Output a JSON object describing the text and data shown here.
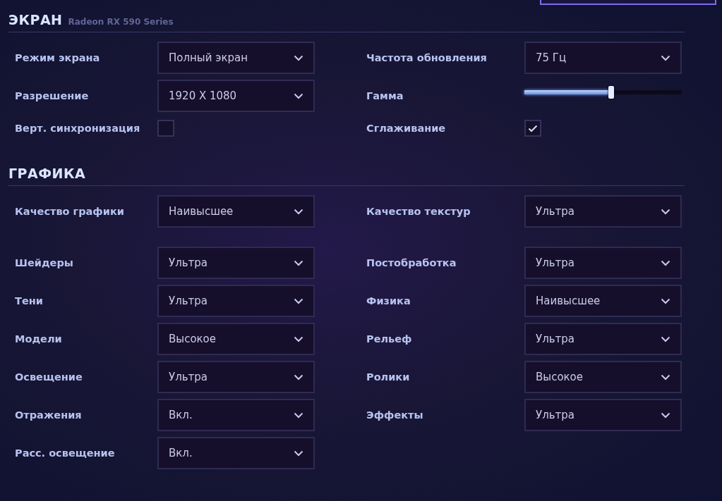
{
  "screen": {
    "title": "ЭКРАН",
    "subtitle": "Radeon RX 590 Series",
    "rows": [
      [
        {
          "kind": "dropdown",
          "label": "Режим экрана",
          "value": "Полный экран"
        },
        {
          "kind": "dropdown",
          "label": "Частота обновления",
          "value": "75 Гц"
        }
      ],
      [
        {
          "kind": "dropdown",
          "label": "Разрешение",
          "value": "1920 X 1080"
        },
        {
          "kind": "slider",
          "label": "Гамма",
          "level": 0.55
        }
      ],
      [
        {
          "kind": "checkbox",
          "label": "Верт. синхронизация",
          "checked": false
        },
        {
          "kind": "checkbox",
          "label": "Сглаживание",
          "checked": true
        }
      ]
    ]
  },
  "graphics": {
    "title": "ГРАФИКА",
    "rows": [
      [
        {
          "kind": "dropdown",
          "label": "Качество графики",
          "value": "Наивысшее"
        },
        {
          "kind": "dropdown",
          "label": "Качество текстур",
          "value": "Ультра"
        }
      ],
      [
        {
          "kind": "dropdown",
          "label": "Шейдеры",
          "value": "Ультра"
        },
        {
          "kind": "dropdown",
          "label": "Постобработка",
          "value": "Ультра"
        }
      ],
      [
        {
          "kind": "dropdown",
          "label": "Тени",
          "value": "Ультра"
        },
        {
          "kind": "dropdown",
          "label": "Физика",
          "value": "Наивысшее"
        }
      ],
      [
        {
          "kind": "dropdown",
          "label": "Модели",
          "value": "Высокое"
        },
        {
          "kind": "dropdown",
          "label": "Рельеф",
          "value": "Ультра"
        }
      ],
      [
        {
          "kind": "dropdown",
          "label": "Освещение",
          "value": "Ультра"
        },
        {
          "kind": "dropdown",
          "label": "Ролики",
          "value": "Высокое"
        }
      ],
      [
        {
          "kind": "dropdown",
          "label": "Отражения",
          "value": "Вкл."
        },
        {
          "kind": "dropdown",
          "label": "Эффекты",
          "value": "Ультра"
        }
      ],
      [
        {
          "kind": "dropdown",
          "label": "Расс. освещение",
          "value": "Вкл."
        }
      ]
    ]
  }
}
